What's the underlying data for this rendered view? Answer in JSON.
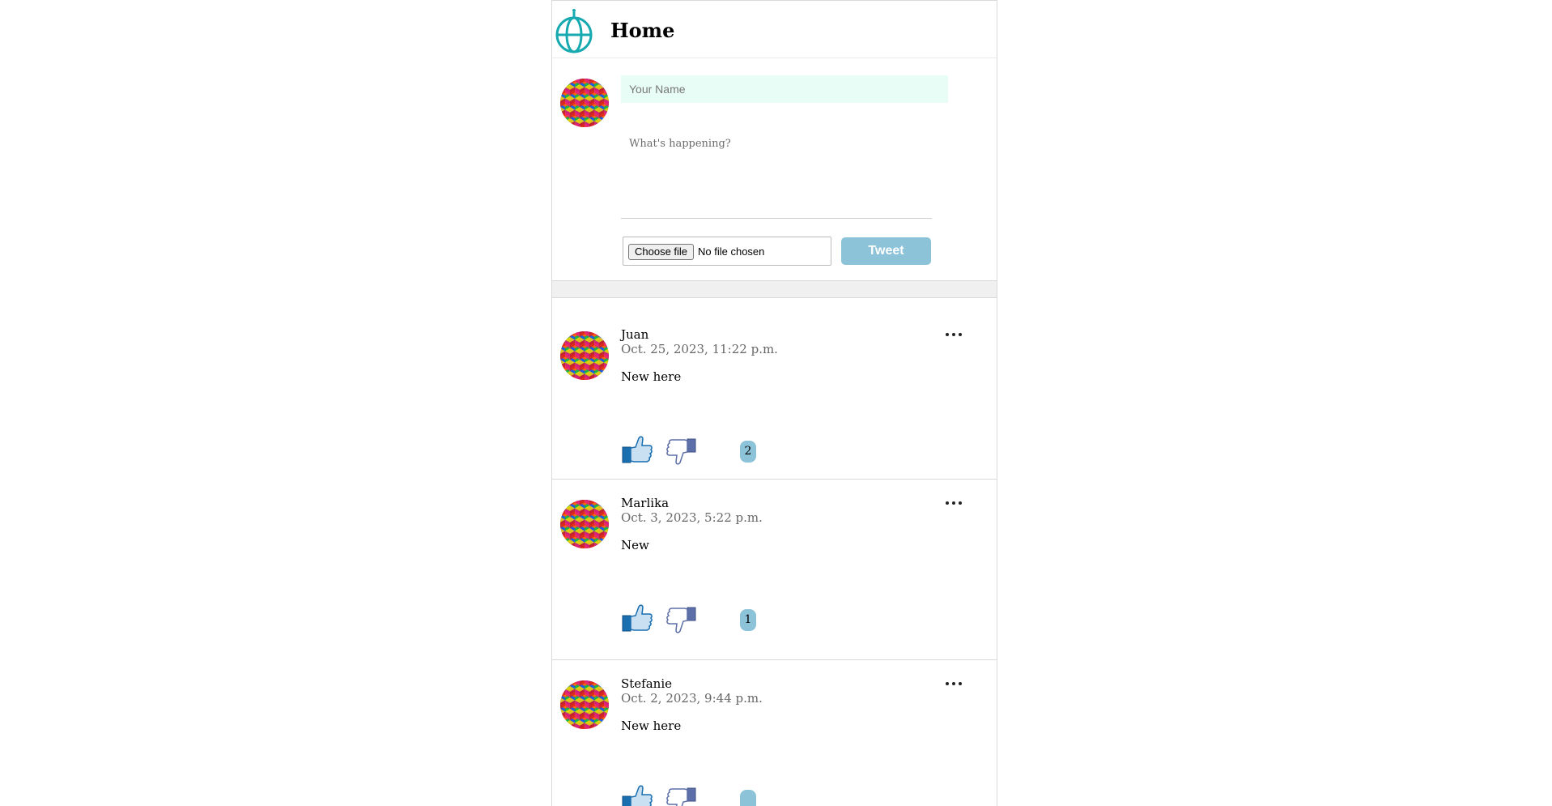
{
  "header": {
    "title": "Home",
    "logo_icon": "globe-icon"
  },
  "compose": {
    "name_placeholder": "Your Name",
    "status_placeholder": "What's happening?",
    "file_button_label": "Choose file",
    "file_status": "No file chosen",
    "tweet_label": "Tweet"
  },
  "posts": [
    {
      "author": "Juan",
      "date": "Oct. 25, 2023, 11:22 p.m.",
      "text": "New here",
      "count": "2"
    },
    {
      "author": "Marlika",
      "date": "Oct. 3, 2023, 5:22 p.m.",
      "text": "New",
      "count": "1"
    },
    {
      "author": "Stefanie",
      "date": "Oct. 2, 2023, 9:44 p.m.",
      "text": "New here",
      "count": ""
    }
  ],
  "colors": {
    "accent": "#17a9b0",
    "tweet_button": "#8cc3d8",
    "name_field_bg": "#e8fdf6",
    "like_blue": "#1a6fb0"
  }
}
